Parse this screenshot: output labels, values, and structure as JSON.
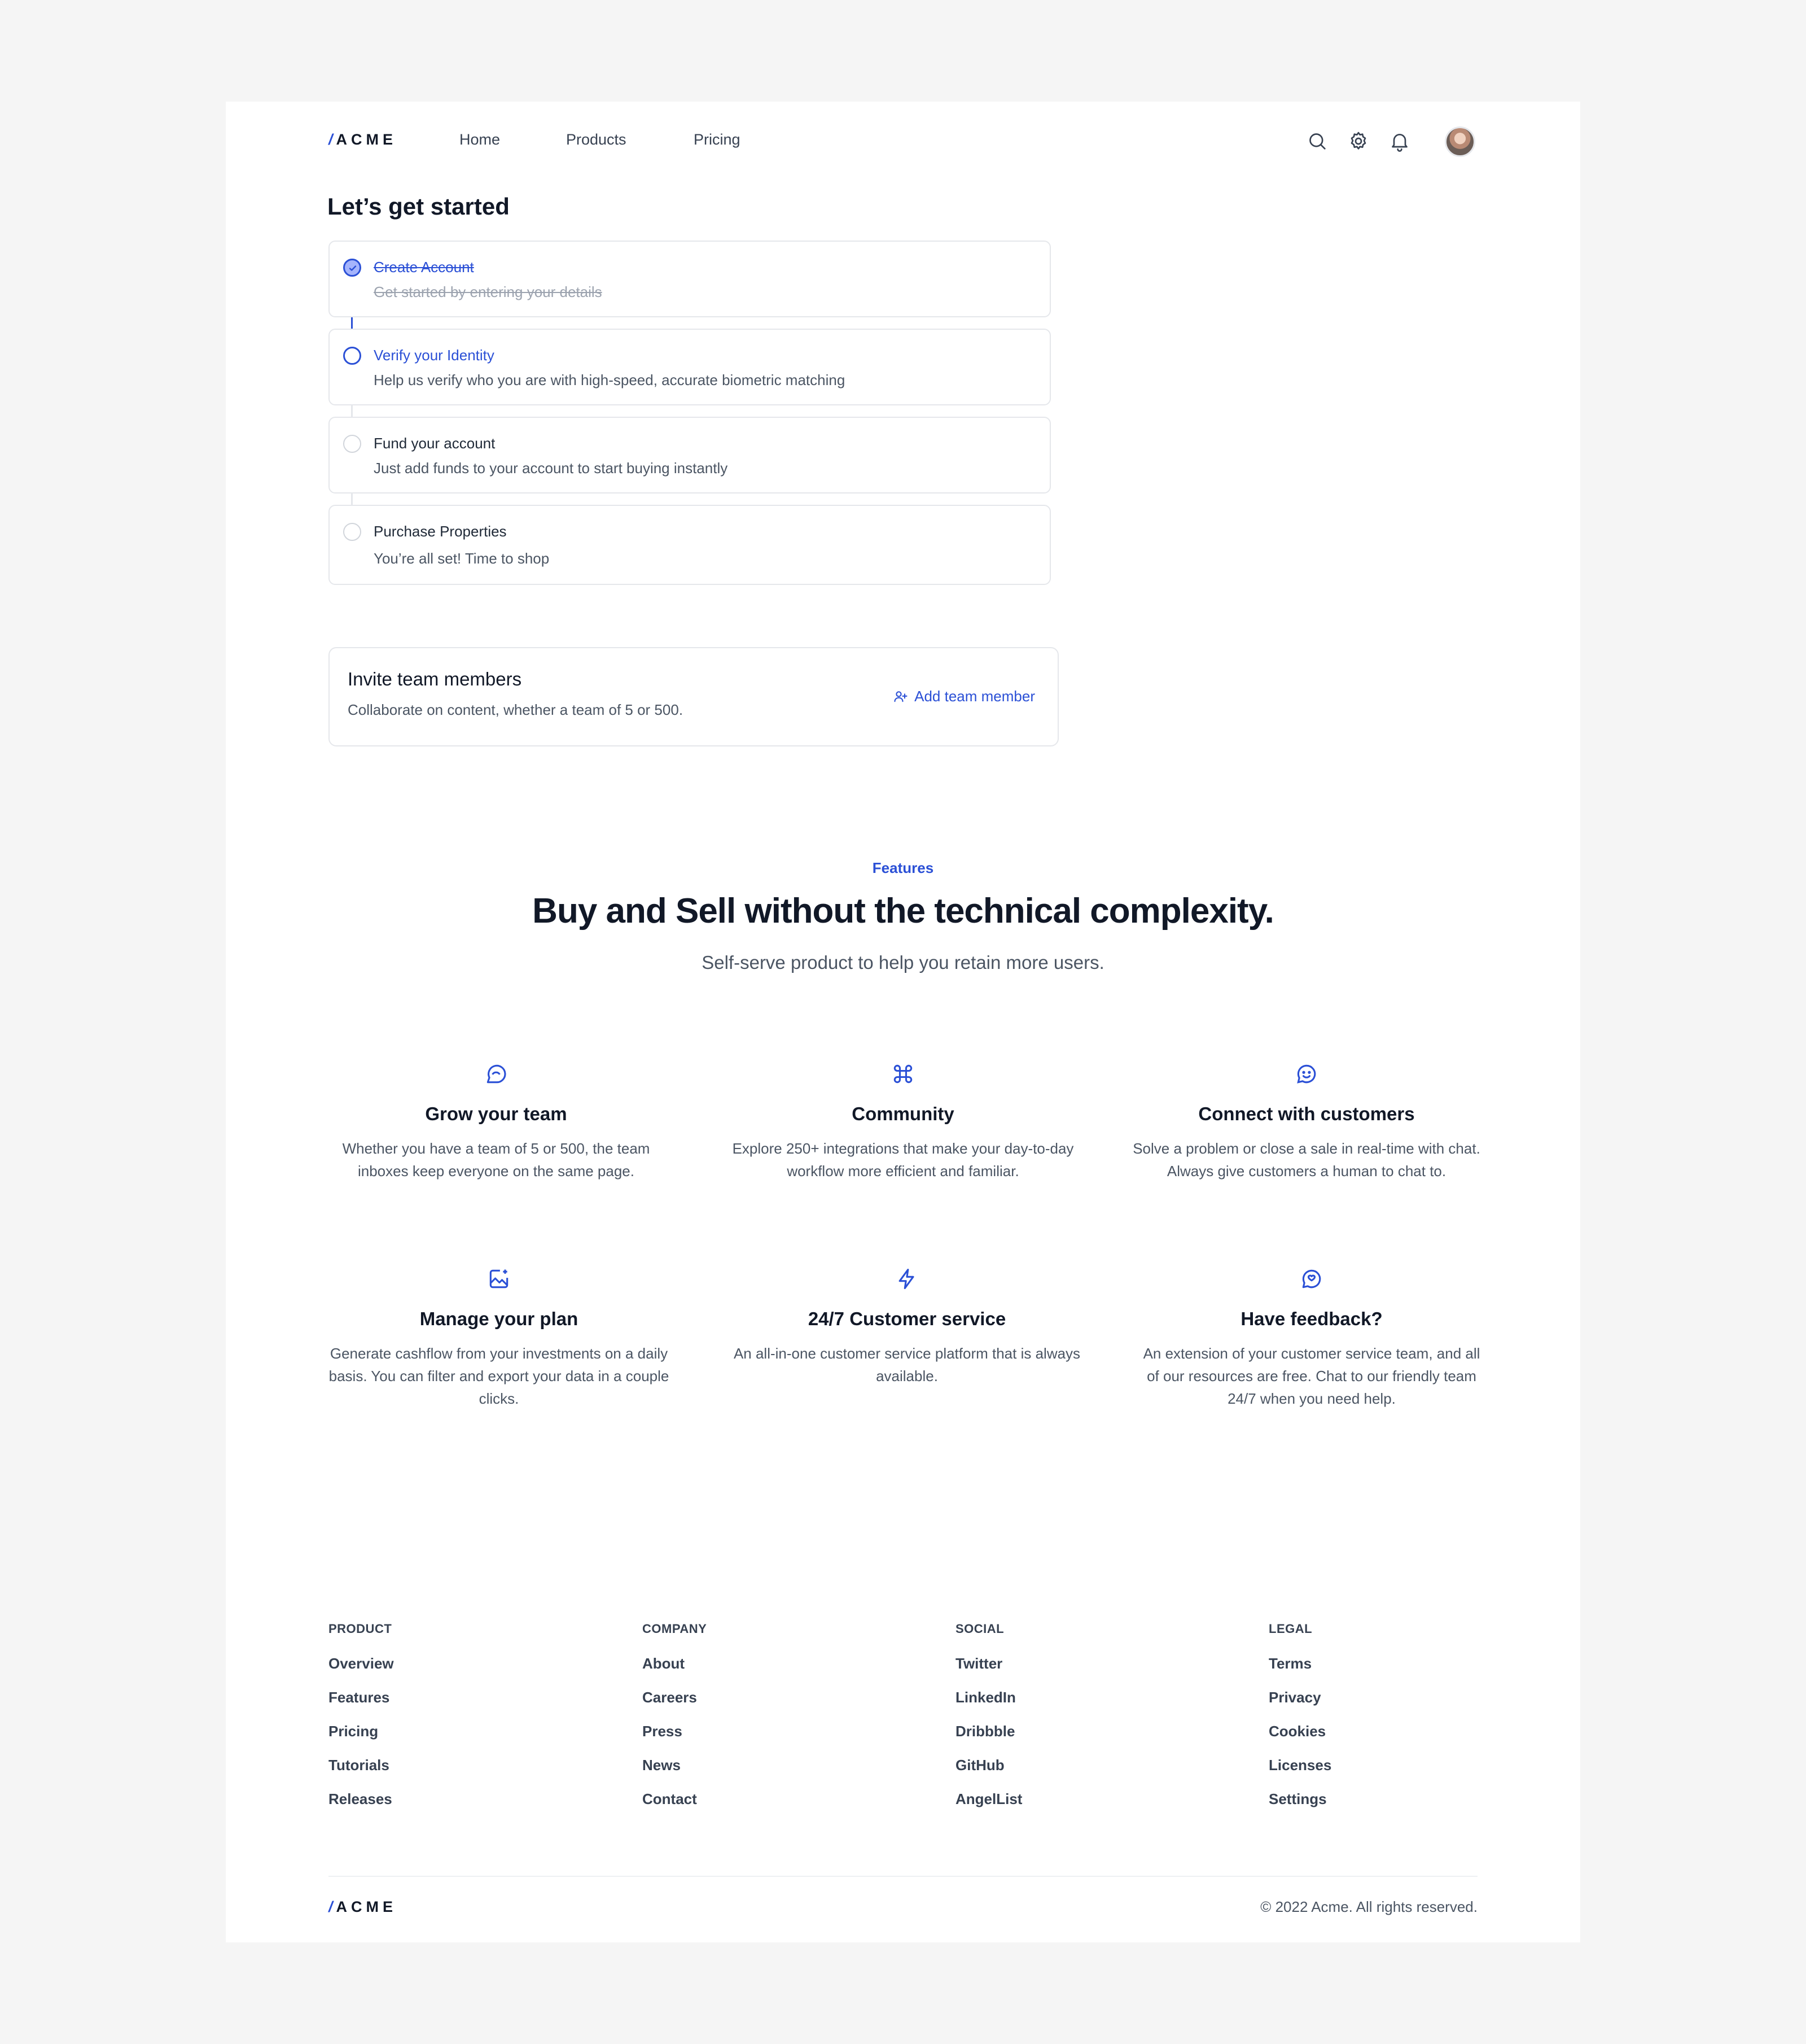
{
  "brand": {
    "slash": "/",
    "name": "ACME"
  },
  "nav": {
    "links": [
      "Home",
      "Products",
      "Pricing"
    ]
  },
  "header_icons": [
    "search-icon",
    "gear-icon",
    "bell-icon"
  ],
  "colors": {
    "accent": "#2b50d6",
    "text": "#111827",
    "muted": "#4b5563",
    "border": "#e5e7eb",
    "background": "#f5f5f5"
  },
  "onboarding": {
    "title": "Let’s get started",
    "steps": [
      {
        "title": "Create Account",
        "desc": "Get started by entering your details",
        "status": "done"
      },
      {
        "title": "Verify your Identity",
        "desc": "Help us verify who you are with high-speed, accurate biometric matching",
        "status": "current"
      },
      {
        "title": "Fund your account",
        "desc": "Just add funds to your account to start buying instantly",
        "status": "pending"
      },
      {
        "title": "Purchase Properties",
        "desc": "You’re all set! Time to shop",
        "status": "pending"
      }
    ]
  },
  "invite": {
    "title": "Invite team members",
    "desc": "Collaborate on content, whether a team of 5 or 500.",
    "button": "Add team member"
  },
  "features": {
    "eyebrow": "Features",
    "headline": "Buy and Sell without the technical complexity.",
    "subhead": "Self-serve product to help you retain more users.",
    "items": [
      {
        "icon": "chat-bubble-icon",
        "title": "Grow your team",
        "desc": "Whether you have a team of 5 or 500, the team inboxes keep everyone on the same page."
      },
      {
        "icon": "command-icon",
        "title": "Community",
        "desc": "Explore 250+ integrations that make your day-to-day workflow more efficient and familiar."
      },
      {
        "icon": "smiley-chat-icon",
        "title": "Connect with customers",
        "desc": "Solve a problem or close a sale in real-time with chat. Always give customers a human to chat to."
      },
      {
        "icon": "image-sparkle-icon",
        "title": "Manage your plan",
        "desc": "Generate cashflow from your investments on a daily basis. You can filter and export your data in a couple clicks."
      },
      {
        "icon": "lightning-icon",
        "title": "24/7 Customer service",
        "desc": "An all-in-one customer service platform that is always available."
      },
      {
        "icon": "feedback-chat-icon",
        "title": "Have feedback?",
        "desc": "An extension of your customer service team, and all of our resources are free. Chat to our friendly team 24/7 when you need help."
      }
    ]
  },
  "footer": {
    "columns": [
      {
        "heading": "PRODUCT",
        "links": [
          "Overview",
          "Features",
          "Pricing",
          "Tutorials",
          "Releases"
        ]
      },
      {
        "heading": "COMPANY",
        "links": [
          "About",
          "Careers",
          "Press",
          "News",
          "Contact"
        ]
      },
      {
        "heading": "SOCIAL",
        "links": [
          "Twitter",
          "LinkedIn",
          "Dribbble",
          "GitHub",
          "AngelList"
        ]
      },
      {
        "heading": "LEGAL",
        "links": [
          "Terms",
          "Privacy",
          "Cookies",
          "Licenses",
          "Settings"
        ]
      }
    ],
    "copyright": "© 2022 Acme. All rights reserved."
  }
}
